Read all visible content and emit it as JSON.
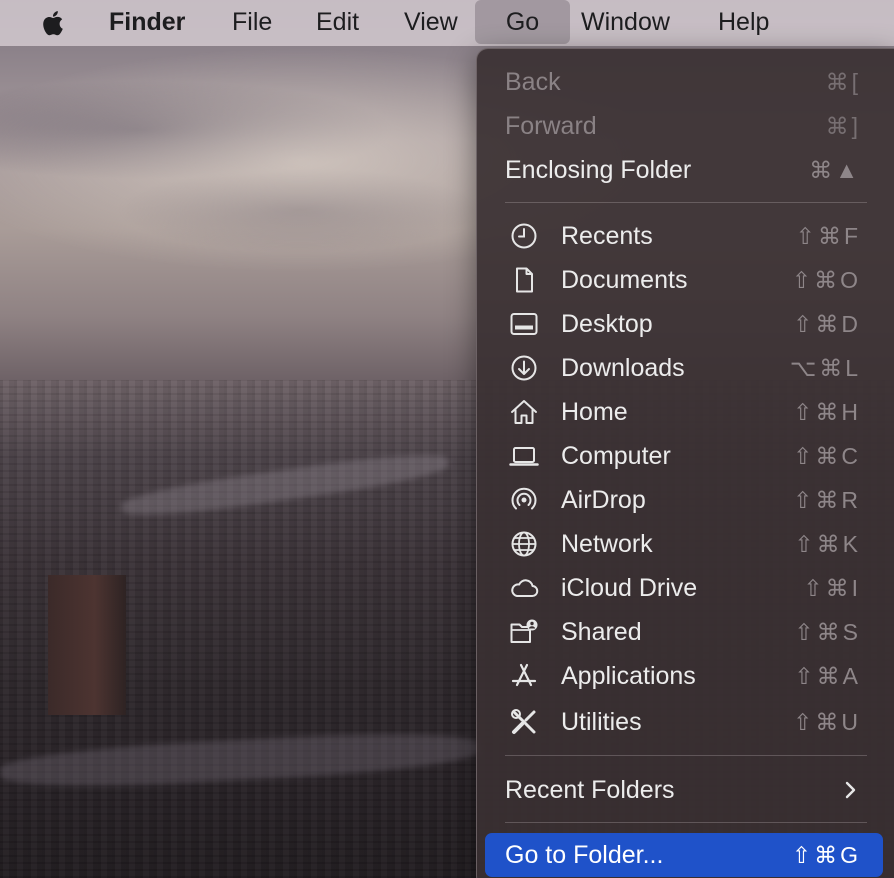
{
  "menubar": {
    "app_name": "Finder",
    "items": [
      "File",
      "Edit",
      "View",
      "Go",
      "Window",
      "Help"
    ],
    "active_item": "Go"
  },
  "go_menu": {
    "top_items": [
      {
        "label": "Back",
        "shortcut": "⌘[",
        "enabled": false
      },
      {
        "label": "Forward",
        "shortcut": "⌘]",
        "enabled": false
      },
      {
        "label": "Enclosing Folder",
        "shortcut": "⌘▲",
        "enabled": true
      }
    ],
    "places": [
      {
        "label": "Recents",
        "shortcut": "⇧⌘F",
        "icon": "clock-icon"
      },
      {
        "label": "Documents",
        "shortcut": "⇧⌘O",
        "icon": "document-icon"
      },
      {
        "label": "Desktop",
        "shortcut": "⇧⌘D",
        "icon": "desktop-icon"
      },
      {
        "label": "Downloads",
        "shortcut": "⌥⌘L",
        "icon": "download-icon"
      },
      {
        "label": "Home",
        "shortcut": "⇧⌘H",
        "icon": "home-icon"
      },
      {
        "label": "Computer",
        "shortcut": "⇧⌘C",
        "icon": "laptop-icon"
      },
      {
        "label": "AirDrop",
        "shortcut": "⇧⌘R",
        "icon": "airdrop-icon"
      },
      {
        "label": "Network",
        "shortcut": "⇧⌘K",
        "icon": "globe-icon"
      },
      {
        "label": "iCloud Drive",
        "shortcut": "⇧⌘I",
        "icon": "cloud-icon"
      },
      {
        "label": "Shared",
        "shortcut": "⇧⌘S",
        "icon": "shared-folder-icon"
      },
      {
        "label": "Applications",
        "shortcut": "⇧⌘A",
        "icon": "applications-icon"
      },
      {
        "label": "Utilities",
        "shortcut": "⇧⌘U",
        "icon": "utilities-icon"
      }
    ],
    "recent_folders": {
      "label": "Recent Folders",
      "icon": "chevron-right-icon"
    },
    "go_to_folder": {
      "label": "Go to Folder...",
      "shortcut": "⇧⌘G"
    }
  },
  "colors": {
    "highlight": "#1f52c9",
    "menu_bg": "#3a3032",
    "menubar_bg": "#d2c8ce"
  }
}
